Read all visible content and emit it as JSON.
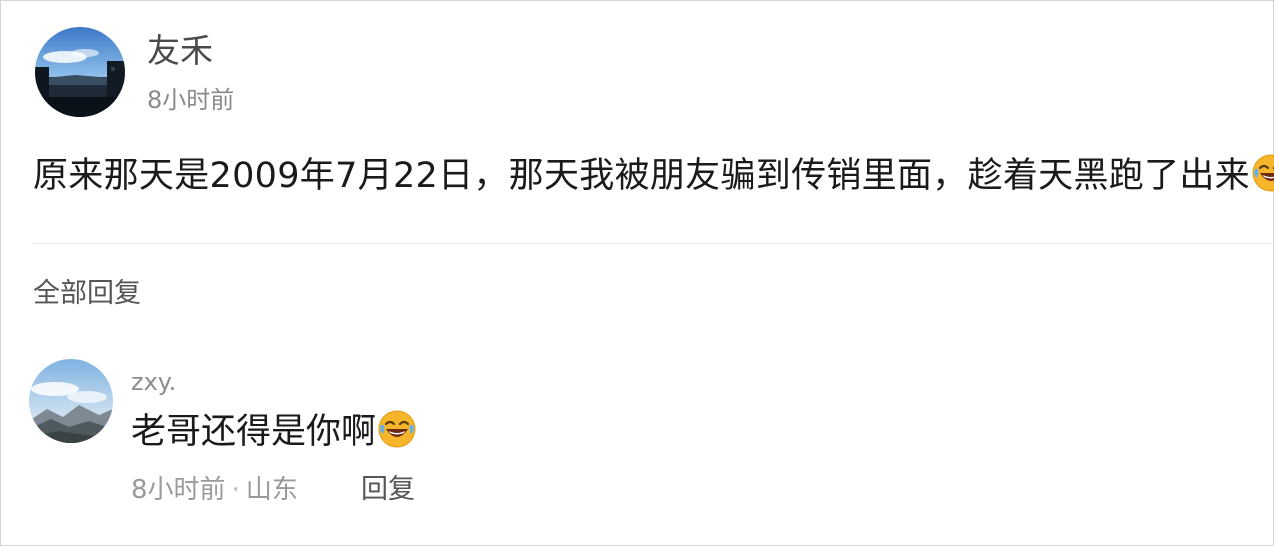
{
  "post": {
    "author": "友禾",
    "time": "8小时前",
    "content": "原来那天是2009年7月22日，那天我被朋友骗到传销里面，趁着天黑跑了出来",
    "emoji": "laughing-crying-emoji"
  },
  "replies_section": {
    "title": "全部回复"
  },
  "reply": {
    "author": "zxy.",
    "content": "老哥还得是你啊",
    "emoji": "laughing-crying-emoji",
    "time": "8小时前",
    "separator": "·",
    "location": "山东",
    "reply_label": "回复"
  },
  "colors": {
    "background": "#ffffff",
    "text": "#1a1a1a",
    "secondary_text": "#8a8a8a",
    "divider": "#ececec",
    "emoji_yellow": "#f7b52c"
  }
}
